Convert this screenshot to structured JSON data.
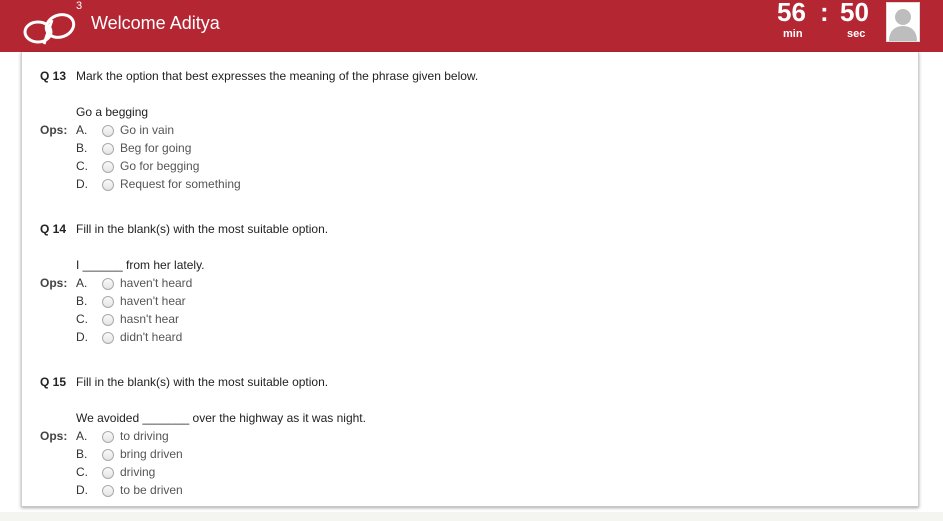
{
  "header": {
    "logo_superscript": "3",
    "welcome_text": "Welcome Aditya",
    "timer": {
      "minutes": "56",
      "separator": ":",
      "seconds": "50",
      "min_label": "min",
      "sec_label": "sec"
    },
    "brand_color": "#b52633"
  },
  "ops_label": "Ops:",
  "questions": [
    {
      "number": "Q 13",
      "text": "Mark the option that best expresses the meaning of the phrase given below.",
      "phrase": "Go a begging",
      "options": [
        {
          "letter": "A.",
          "text": "Go in vain"
        },
        {
          "letter": "B.",
          "text": "Beg for going"
        },
        {
          "letter": "C.",
          "text": "Go for begging"
        },
        {
          "letter": "D.",
          "text": "Request for something"
        }
      ]
    },
    {
      "number": "Q 14",
      "text": "Fill in the blank(s) with the most suitable option.",
      "phrase": "I ______ from her lately.",
      "options": [
        {
          "letter": "A.",
          "text": "haven't heard"
        },
        {
          "letter": "B.",
          "text": "haven't hear"
        },
        {
          "letter": "C.",
          "text": "hasn't hear"
        },
        {
          "letter": "D.",
          "text": "didn't heard"
        }
      ]
    },
    {
      "number": "Q 15",
      "text": "Fill in the blank(s) with the most suitable option.",
      "phrase": "We avoided _______ over the highway as it was night.",
      "options": [
        {
          "letter": "A.",
          "text": "to driving"
        },
        {
          "letter": "B.",
          "text": "bring driven"
        },
        {
          "letter": "C.",
          "text": "driving"
        },
        {
          "letter": "D.",
          "text": "to be driven"
        }
      ]
    }
  ]
}
